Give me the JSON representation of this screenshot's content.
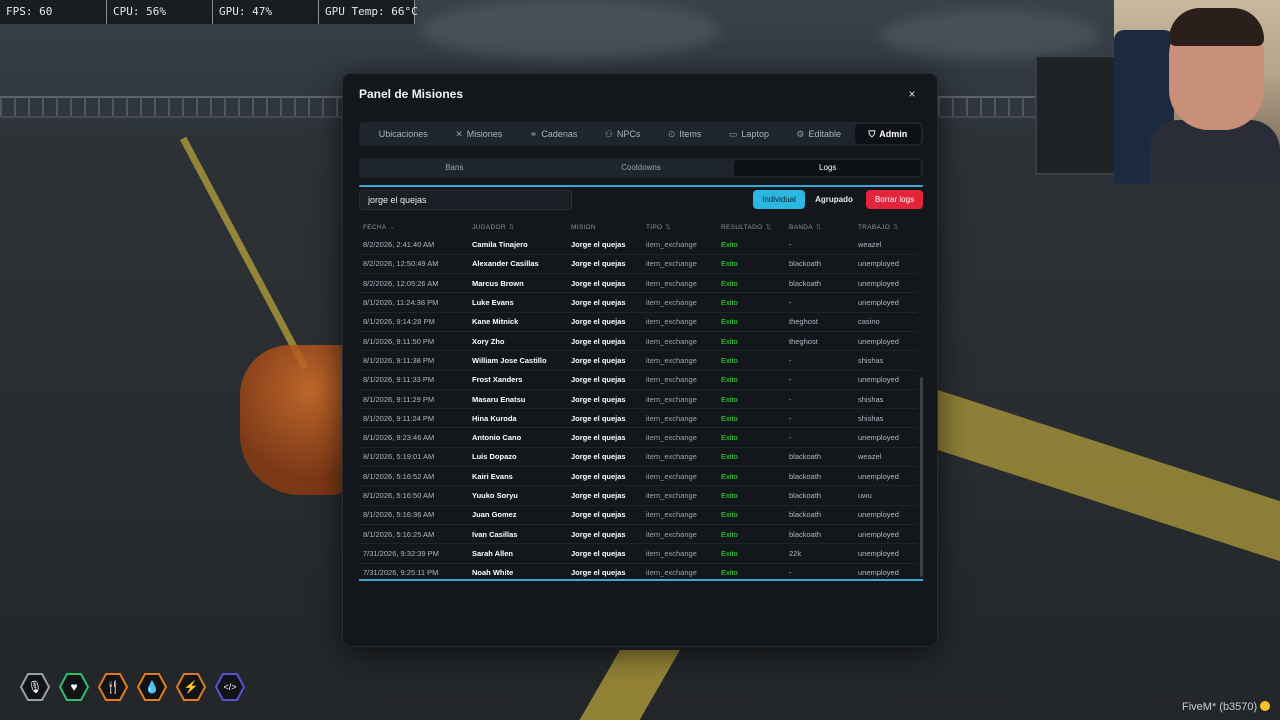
{
  "perf": {
    "fps": "FPS: 60",
    "cpu": "CPU: 56%",
    "gpu": "GPU: 47%",
    "gpu_temp": "GPU Temp: 66°C"
  },
  "panel": {
    "title": "Panel de Misiones",
    "close": "×",
    "tabs": [
      {
        "label": "Ubicaciones",
        "icon": ""
      },
      {
        "label": "Misiones",
        "icon": "✕"
      },
      {
        "label": "Cadenas",
        "icon": "⚭"
      },
      {
        "label": "NPCs",
        "icon": "⚇"
      },
      {
        "label": "Items",
        "icon": "⊙"
      },
      {
        "label": "Laptop",
        "icon": "▭"
      },
      {
        "label": "Editable",
        "icon": "⚙"
      },
      {
        "label": "Admin",
        "icon": "⛉"
      }
    ],
    "active_tab": "Admin",
    "subtabs": [
      "Bans",
      "Cooldowns",
      "Logs"
    ],
    "active_subtab": "Logs",
    "search_value": "jorge el quejas",
    "buttons": {
      "individual": "Individual",
      "agrupado": "Agrupado",
      "borrar": "Borrar logs"
    },
    "columns": [
      "FECHA",
      "JUGADOR",
      "MISION",
      "TIPO",
      "RESULTADO",
      "BANDA",
      "TRABAJO"
    ],
    "rows": [
      [
        "8/2/2026, 2:41:40 AM",
        "Camila Tinajero",
        "Jorge el quejas",
        "item_exchange",
        "Exito",
        "-",
        "weazel"
      ],
      [
        "8/2/2026, 12:50:49 AM",
        "Alexander Casillas",
        "Jorge el quejas",
        "item_exchange",
        "Exito",
        "blackoath",
        "unemployed"
      ],
      [
        "8/2/2026, 12:05:26 AM",
        "Marcus Brown",
        "Jorge el quejas",
        "item_exchange",
        "Exito",
        "blackoath",
        "unemployed"
      ],
      [
        "8/1/2026, 11:24:38 PM",
        "Luke Evans",
        "Jorge el quejas",
        "item_exchange",
        "Exito",
        "-",
        "unemployed"
      ],
      [
        "8/1/2026, 9:14:28 PM",
        "Kane Mitnick",
        "Jorge el quejas",
        "item_exchange",
        "Exito",
        "theghost",
        "casino"
      ],
      [
        "8/1/2026, 9:11:50 PM",
        "Xory Zho",
        "Jorge el quejas",
        "item_exchange",
        "Exito",
        "theghost",
        "unemployed"
      ],
      [
        "8/1/2026, 9:11:38 PM",
        "William Jose Castillo",
        "Jorge el quejas",
        "item_exchange",
        "Exito",
        "-",
        "shishas"
      ],
      [
        "8/1/2026, 9:11:33 PM",
        "Frost Xanders",
        "Jorge el quejas",
        "item_exchange",
        "Exito",
        "-",
        "unemployed"
      ],
      [
        "8/1/2026, 9:11:29 PM",
        "Masaru Enatsu",
        "Jorge el quejas",
        "item_exchange",
        "Exito",
        "-",
        "shishas"
      ],
      [
        "8/1/2026, 9:11:24 PM",
        "Hina Kuroda",
        "Jorge el quejas",
        "item_exchange",
        "Exito",
        "-",
        "shishas"
      ],
      [
        "8/1/2026, 9:23:46 AM",
        "Antonio Cano",
        "Jorge el quejas",
        "item_exchange",
        "Exito",
        "-",
        "unemployed"
      ],
      [
        "8/1/2026, 5:19:01 AM",
        "Luis Dopazo",
        "Jorge el quejas",
        "item_exchange",
        "Exito",
        "blackoath",
        "weazel"
      ],
      [
        "8/1/2026, 5:16:52 AM",
        "Kairi Evans",
        "Jorge el quejas",
        "item_exchange",
        "Exito",
        "blackoath",
        "unemployed"
      ],
      [
        "8/1/2026, 5:16:50 AM",
        "Yuuko Soryu",
        "Jorge el quejas",
        "item_exchange",
        "Exito",
        "blackoath",
        "uwu"
      ],
      [
        "8/1/2026, 5:16:36 AM",
        "Juan Gomez",
        "Jorge el quejas",
        "item_exchange",
        "Exito",
        "blackoath",
        "unemployed"
      ],
      [
        "8/1/2026, 5:16:25 AM",
        "Ivan Casillas",
        "Jorge el quejas",
        "item_exchange",
        "Exito",
        "blackoath",
        "unemployed"
      ],
      [
        "7/31/2026, 9:32:39 PM",
        "Sarah Allen",
        "Jorge el quejas",
        "item_exchange",
        "Exito",
        "22k",
        "unemployed"
      ],
      [
        "7/31/2026, 9:25:11 PM",
        "Noah White",
        "Jorge el quejas",
        "item_exchange",
        "Exito",
        "-",
        "unemployed"
      ]
    ]
  },
  "hud": {
    "icons": [
      {
        "name": "mic-icon",
        "glyph": "🎙",
        "color": "#9aa0a6"
      },
      {
        "name": "heart-icon",
        "glyph": "♥",
        "color": "#2fbf6a"
      },
      {
        "name": "food-icon",
        "glyph": "🍴",
        "color": "#e07b22"
      },
      {
        "name": "water-icon",
        "glyph": "💧",
        "color": "#e07b22"
      },
      {
        "name": "stamina-icon",
        "glyph": "⚡",
        "color": "#e07b22"
      },
      {
        "name": "code-icon",
        "glyph": "</>",
        "color": "#5b4fd6"
      }
    ]
  },
  "footer": {
    "fivem": "FiveM* (b3570)"
  },
  "colors": {
    "accent": "#3ba7d4",
    "individual_btn": "#2ab7e0",
    "delete_btn": "#e3243b",
    "success": "#3ee23e"
  }
}
